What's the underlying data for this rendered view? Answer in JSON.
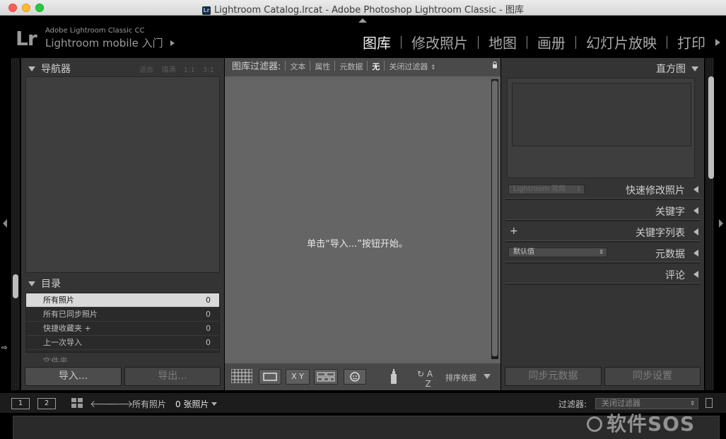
{
  "window": {
    "title": "Lightroom Catalog.lrcat - Adobe Photoshop Lightroom Classic - 图库",
    "app_badge": "Lr"
  },
  "identity": {
    "logo": "Lr",
    "small": "Adobe Lightroom Classic CC",
    "main": "Lightroom mobile 入门"
  },
  "modules": [
    "图库",
    "修改照片",
    "地图",
    "画册",
    "幻灯片放映",
    "打印"
  ],
  "left_panel": {
    "navigator_title": "导航器",
    "navigator_options": "适合 填满 1:1 3:1",
    "catalog_title": "目录",
    "catalog_items": [
      {
        "label": "所有照片",
        "count": "0"
      },
      {
        "label": "所有已同步照片",
        "count": "0"
      },
      {
        "label": "快捷收藏夹 +",
        "count": "0"
      },
      {
        "label": "上一次导入",
        "count": "0"
      }
    ],
    "folders_title": "文件夹",
    "import_label": "导入...",
    "export_label": "导出..."
  },
  "filter_bar": {
    "label": "图库过滤器:",
    "text": "文本",
    "attribute": "属性",
    "metadata": "元数据",
    "none": "无",
    "off": "关闭过滤器"
  },
  "center": {
    "empty_message": "单击“导入...”按钮开始。"
  },
  "toolbar": {
    "compare_label": "X Y",
    "sort_label": "排序依据"
  },
  "right_panel": {
    "histogram_title": "直方图",
    "quick_develop_select": "Lightroom 常规",
    "quick_develop_title": "快速修改照片",
    "keywording_title": "关键字",
    "keyword_list_title": "关键字列表",
    "metadata_select": "默认值",
    "metadata_title": "元数据",
    "comments_title": "评论",
    "sync_metadata": "同步元数据",
    "sync_settings": "同步设置"
  },
  "filmstrip": {
    "screen1": "1",
    "screen2": "2",
    "source": "所有照片",
    "count": "0 张照片",
    "filter_label": "过滤器:",
    "filter_value": "关闭过滤器"
  },
  "watermark": "软件SOS",
  "colors": {
    "panel": "#343434",
    "center": "#636363",
    "active_module": "#efefef"
  }
}
